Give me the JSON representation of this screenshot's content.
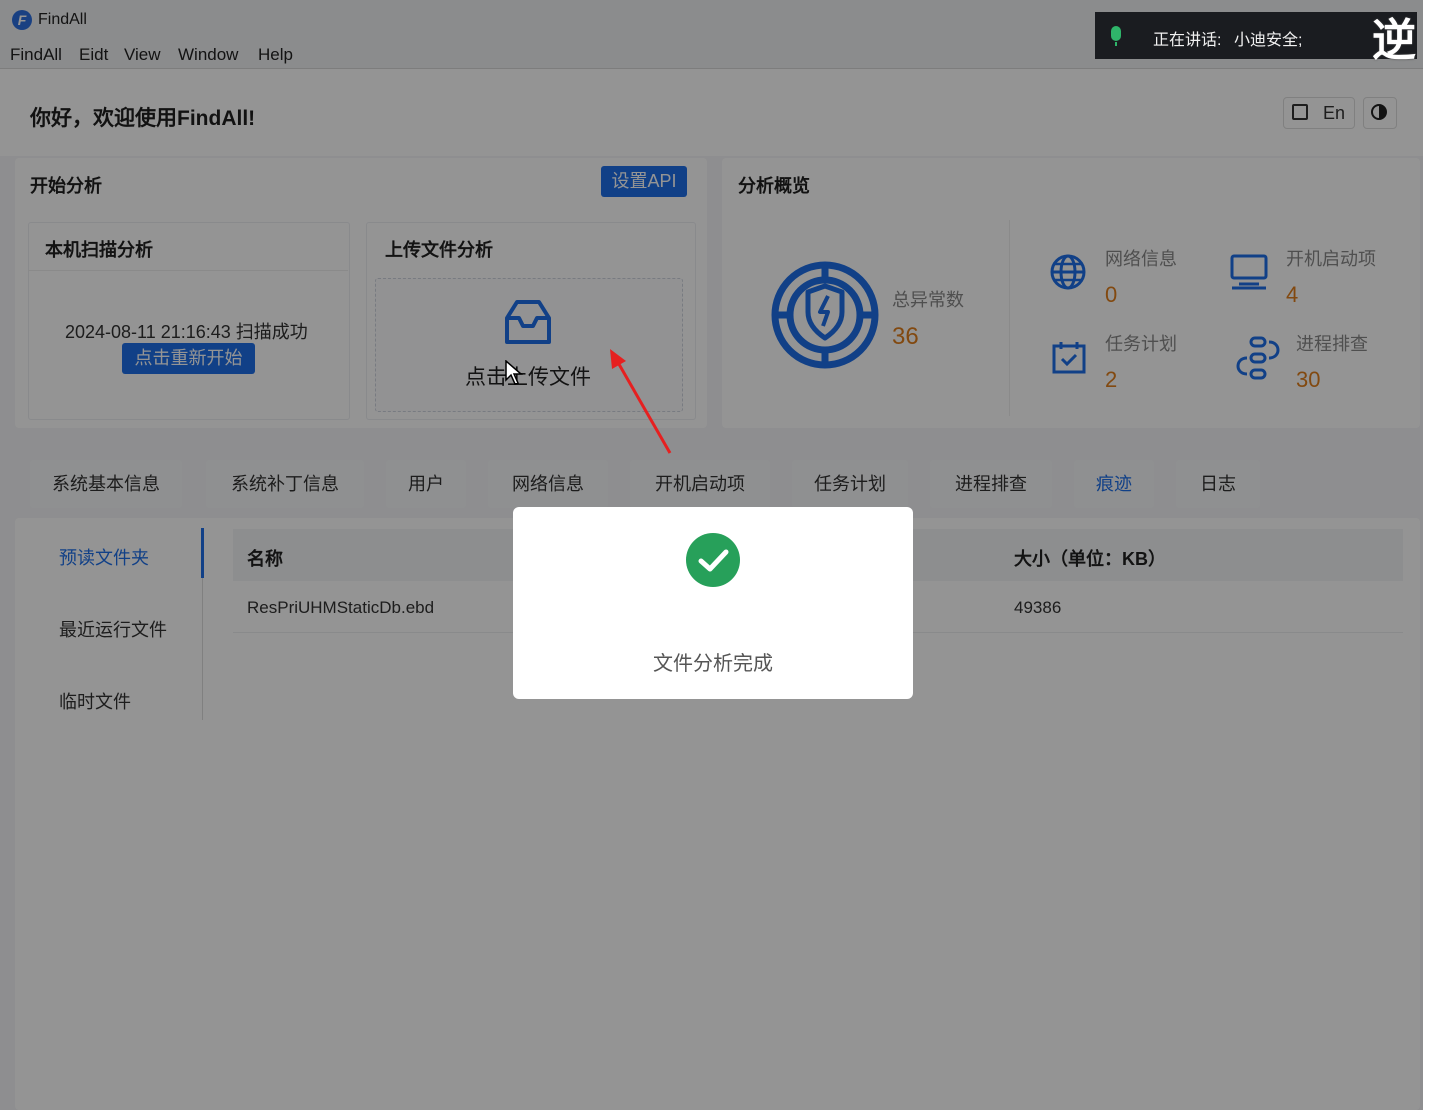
{
  "window": {
    "title": "FindAll"
  },
  "menu": [
    "FindAll",
    "Eidt",
    "View",
    "Window",
    "Help"
  ],
  "speaking_banner": {
    "label": "正在讲话:",
    "name": "小迪安全;",
    "corner_glyph": "逆"
  },
  "header": {
    "greeting": "你好，欢迎使用FindAll!",
    "lang_label": "En"
  },
  "start_analysis": {
    "title": "开始分析",
    "api_button": "设置API",
    "local_scan": {
      "title": "本机扫描分析",
      "status": "2024-08-11 21:16:43 扫描成功",
      "restart_button": "点击重新开始"
    },
    "upload": {
      "title": "上传文件分析",
      "label": "点击上传文件"
    }
  },
  "overview": {
    "title": "分析概览",
    "total": {
      "label": "总异常数",
      "value": "36"
    },
    "stats": [
      {
        "label": "网络信息",
        "value": "0",
        "icon": "globe-icon"
      },
      {
        "label": "开机启动项",
        "value": "4",
        "icon": "monitor-icon"
      },
      {
        "label": "任务计划",
        "value": "2",
        "icon": "calendar-check-icon"
      },
      {
        "label": "进程排查",
        "value": "30",
        "icon": "process-link-icon"
      }
    ]
  },
  "tabs": [
    "系统基本信息",
    "系统补丁信息",
    "用户",
    "网络信息",
    "开机启动项",
    "任务计划",
    "进程排查",
    "痕迹",
    "日志"
  ],
  "active_tab": "痕迹",
  "sidebar": [
    "预读文件夹",
    "最近运行文件",
    "临时文件"
  ],
  "table": {
    "headers": [
      "名称",
      "大小（单位：KB）"
    ],
    "rows": [
      [
        "ResPriUHMStaticDb.ebd",
        "49386"
      ]
    ]
  },
  "modal": {
    "message": "文件分析完成"
  },
  "colors": {
    "accent": "#1e6fe8",
    "value": "#e07f1c",
    "success": "#27a05a"
  }
}
